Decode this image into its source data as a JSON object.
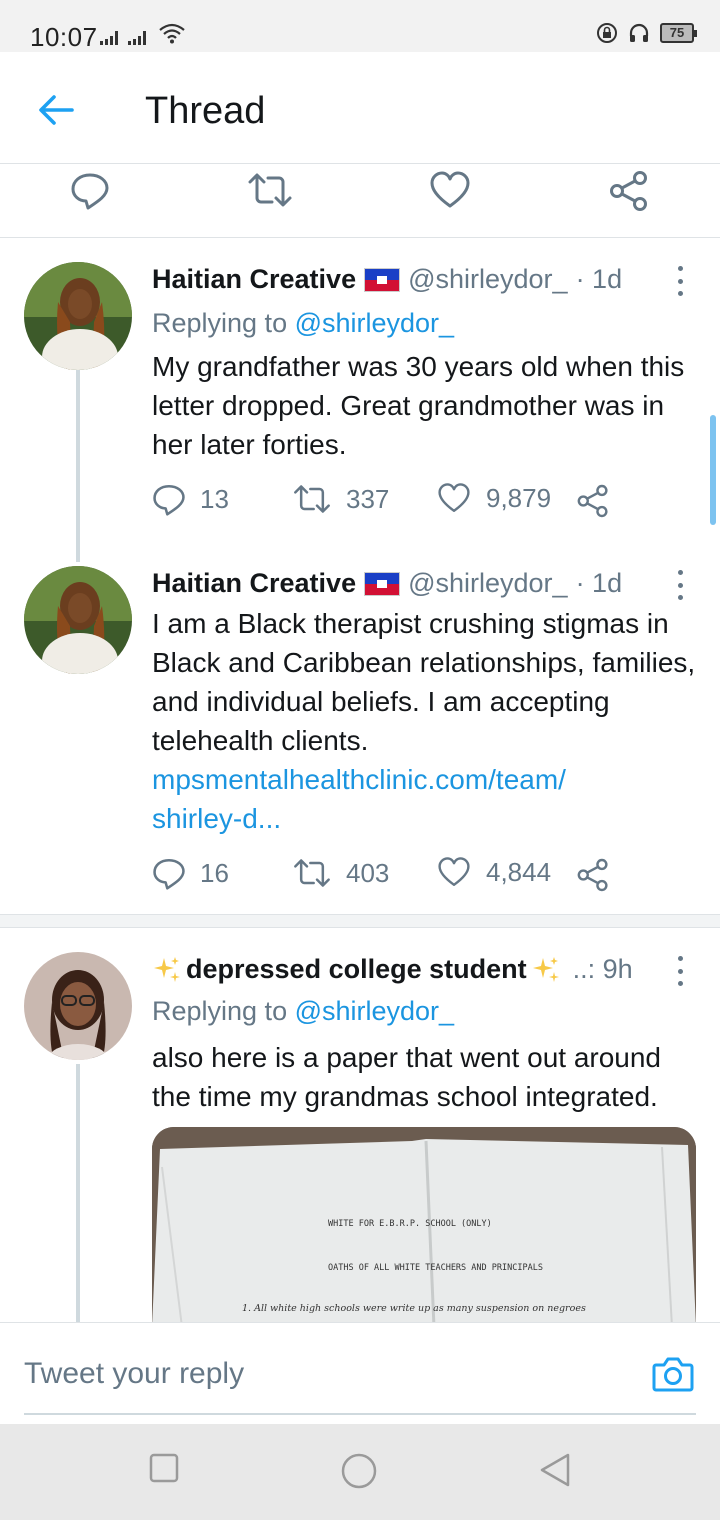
{
  "status_bar": {
    "time": "10:07",
    "battery": "75"
  },
  "header": {
    "title": "Thread"
  },
  "tweets": [
    {
      "name": "Haitian Creative",
      "handle": "@shirleydor_",
      "time": "· 1d",
      "replying_prefix": "Replying to ",
      "replying_to": "@shirleydor_",
      "text": "My grandfather was 30 years old when this letter dropped. Great grandmother was in her later forties.",
      "replies": "13",
      "retweets": "337",
      "likes": "9,879"
    },
    {
      "name": "Haitian Creative",
      "handle": "@shirleydor_",
      "time": "· 1d",
      "text": "I am a Black therapist crushing stigmas in Black and Caribbean relationships, families, and individual beliefs. I am accepting telehealth clients.",
      "link_line1": "mpsmentalhealthclinic.com/team/",
      "link_line2": "shirley-d...",
      "replies": "16",
      "retweets": "403",
      "likes": "4,844"
    },
    {
      "name": "depressed college student",
      "meta": "..: 9h",
      "replying_prefix": "Replying to ",
      "replying_to": "@shirleydor_",
      "text": "also here is a paper that went out around the time my grandmas school integrated."
    }
  ],
  "media": {
    "line1": "WHITE FOR E.B.R.P. SCHOOL (ONLY)",
    "line2": "OATHS OF ALL WHITE TEACHERS AND PRINCIPALS",
    "line3": "1. All white high schools were write up as many suspension on negroes"
  },
  "reply_bar": {
    "placeholder": "Tweet your reply"
  },
  "colors": {
    "accent": "#1da1f2",
    "link": "#1b95e0",
    "muted": "#657786"
  },
  "icons": [
    "back-arrow-icon",
    "reply-icon",
    "retweet-icon",
    "like-icon",
    "share-icon",
    "camera-icon",
    "more-icon"
  ]
}
